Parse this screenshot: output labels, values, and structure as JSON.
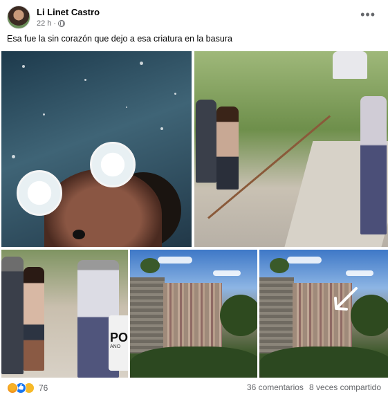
{
  "post": {
    "author": "Li Linet Castro",
    "timestamp": "22 h",
    "privacy_icon": "globe-icon",
    "menu_icon": "more-options-icon",
    "text": "Esa fue la sin corazón que dejo a esa criatura en la basura"
  },
  "photos": [
    {
      "name": "selfie-photo-with-bear-ears-filter"
    },
    {
      "name": "people-on-stairway-photo"
    },
    {
      "name": "woman-and-police-officer-photo"
    },
    {
      "name": "apartment-building-photo"
    },
    {
      "name": "apartment-building-with-arrow-photo"
    }
  ],
  "photo_overlay_text": {
    "police_truck_letters": "PO",
    "police_truck_small": "ANO"
  },
  "footer": {
    "reaction_icons": [
      "angry-reaction-icon",
      "like-reaction-icon",
      "sad-reaction-icon"
    ],
    "reaction_count": "76",
    "comments": "36 comentarios",
    "shares": "8 veces compartido"
  },
  "colors": {
    "text_primary": "#050505",
    "text_secondary": "#65676b",
    "like_blue": "#1877f2"
  }
}
